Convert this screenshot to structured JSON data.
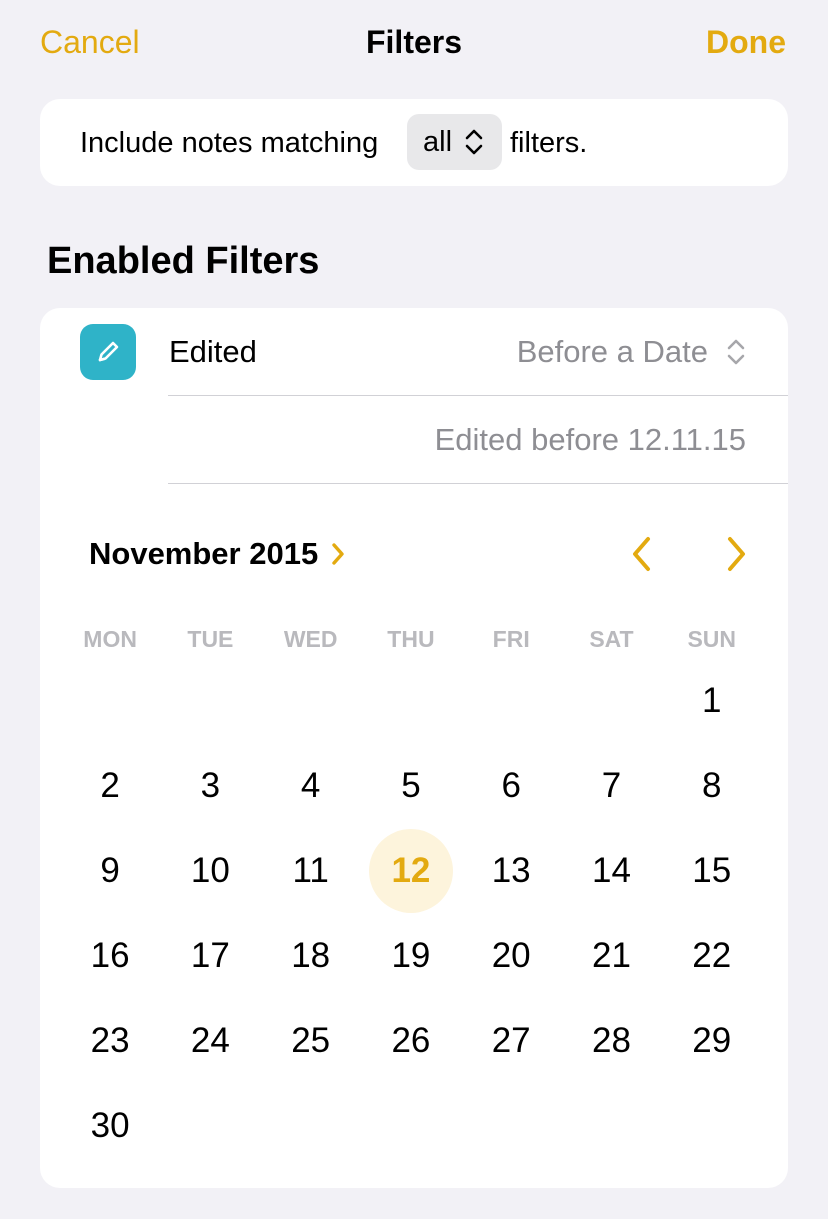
{
  "nav": {
    "cancel_label": "Cancel",
    "title": "Filters",
    "done_label": "Done"
  },
  "match": {
    "prefix": "Include notes matching",
    "selected": "all",
    "suffix": "filters."
  },
  "section_title": "Enabled Filters",
  "filter": {
    "icon": "pencil-icon",
    "label": "Edited",
    "operator": "Before a Date",
    "summary": "Edited before 12.11.15"
  },
  "calendar": {
    "month_label": "November 2015",
    "weekdays": [
      "MON",
      "TUE",
      "WED",
      "THU",
      "FRI",
      "SAT",
      "SUN"
    ],
    "leading_blanks": 6,
    "days": [
      "1",
      "2",
      "3",
      "4",
      "5",
      "6",
      "7",
      "8",
      "9",
      "10",
      "11",
      "12",
      "13",
      "14",
      "15",
      "16",
      "17",
      "18",
      "19",
      "20",
      "21",
      "22",
      "23",
      "24",
      "25",
      "26",
      "27",
      "28",
      "29",
      "30"
    ],
    "selected_day": "12"
  },
  "colors": {
    "accent": "#e3aa10",
    "icon_bg": "#2fb3c8",
    "selected_bg": "#fdf4dc",
    "secondary_text": "#8e8e93"
  }
}
